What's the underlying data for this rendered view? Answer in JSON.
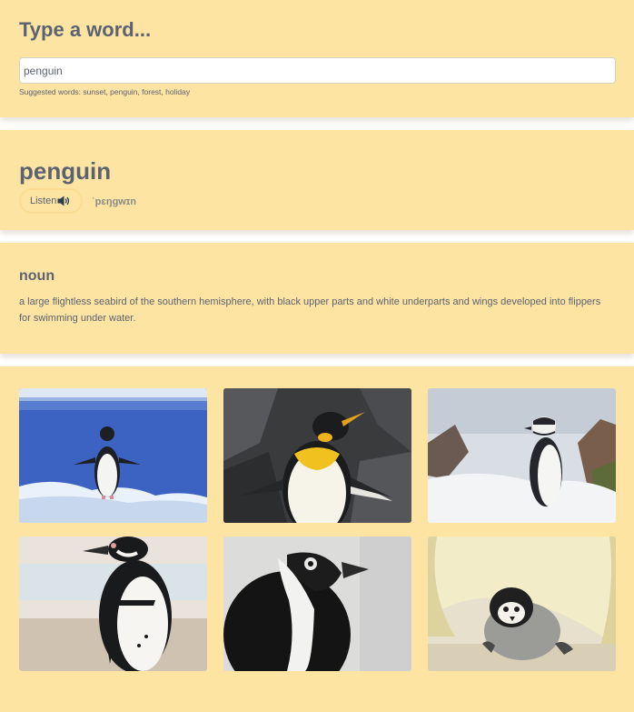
{
  "search": {
    "title": "Type a word...",
    "value": "penguin",
    "suggestion_text": "Suggested words: sunset, penguin, forest, holiday"
  },
  "word": {
    "headword": "penguin",
    "listen_label": "Listen",
    "phonetic": "ˈpɛŋɡwɪn"
  },
  "meaning": {
    "part_of_speech": "noun",
    "definition": "a large flightless seabird of the southern hemisphere, with black upper parts and white underparts and wings developed into flippers for swimming under water."
  },
  "icons": {
    "listen": "speaker-icon"
  },
  "colors": {
    "card_background": "#fee4a3",
    "text": "#5b6270",
    "phonetic": "#8a8c86"
  }
}
